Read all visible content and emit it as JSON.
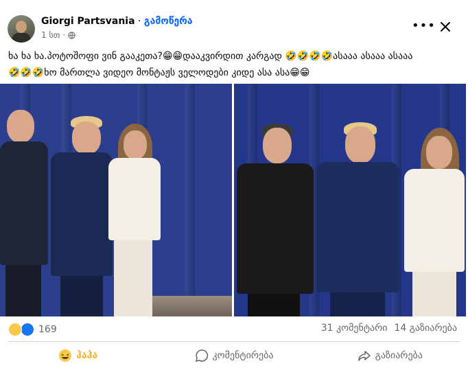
{
  "post": {
    "author": "Giorgi Partsvania",
    "separator": "·",
    "follow_label": "გამოწერა",
    "time": "1 სთ",
    "time_separator": "·",
    "text": "ხა ხა ხა.პოტოშოფი ვინ გააკეთა?😁😁დააკვირდით კარგად 🤣🤣🤣🤣ასააა ასააა ასააა\n🤣🤣🤣ხო მართლა ვიდეო მონტაჟს ველოდები კიდე ასა ასა😁😁",
    "more_icon": "more-options-icon",
    "close_icon": "close-icon"
  },
  "photos": [
    {
      "name": "photo-left",
      "icon": "image"
    },
    {
      "name": "photo-right",
      "icon": "image"
    }
  ],
  "stats": {
    "reactions_count": "169",
    "comments": "31 კომენტარი",
    "shares": "14 გაზიარება"
  },
  "actions": {
    "haha_label": "ჰაჰა",
    "comment_label": "კომენტირება",
    "share_label": "გაზიარება"
  },
  "colors": {
    "link": "#0866ff",
    "muted": "#65676b",
    "haha": "#f7b125",
    "like": "#1877f2"
  }
}
